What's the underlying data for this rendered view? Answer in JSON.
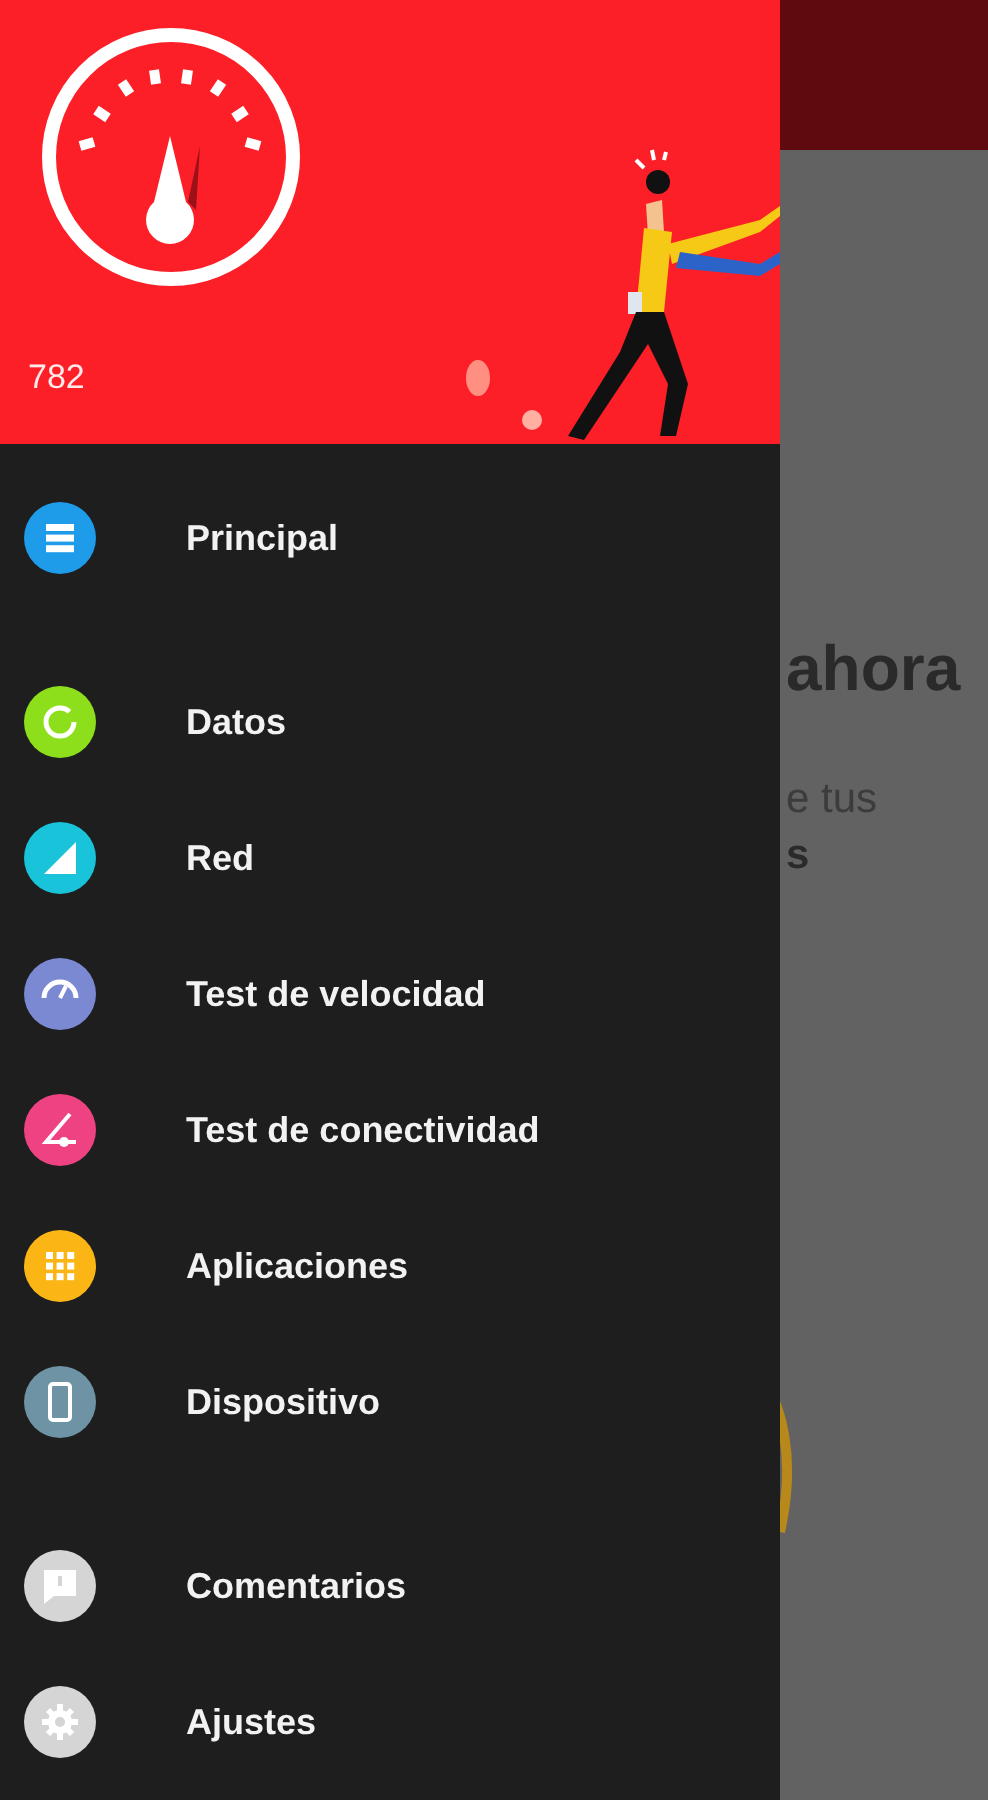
{
  "header": {
    "count": "782"
  },
  "background": {
    "heading": "ahora",
    "lines": [
      "e tus",
      "s"
    ]
  },
  "menu_groups": [
    [
      {
        "label": "Principal",
        "kind": "list",
        "color": "#1e9be9"
      }
    ],
    [
      {
        "label": "Datos",
        "kind": "ring",
        "color": "#8edf1b"
      },
      {
        "label": "Red",
        "kind": "signal",
        "color": "#19c3d9"
      },
      {
        "label": "Test de velocidad",
        "kind": "gauge",
        "color": "#7b88d2"
      },
      {
        "label": "Test de conectividad",
        "kind": "triangle",
        "color": "#ee4283"
      },
      {
        "label": "Aplicaciones",
        "kind": "grid",
        "color": "#fbb615"
      },
      {
        "label": "Dispositivo",
        "kind": "phone",
        "color": "#6e93a4"
      }
    ],
    [
      {
        "label": "Comentarios",
        "kind": "comment",
        "color": "#d5d5d5"
      },
      {
        "label": "Ajustes",
        "kind": "gear",
        "color": "#d5d5d5"
      }
    ]
  ]
}
